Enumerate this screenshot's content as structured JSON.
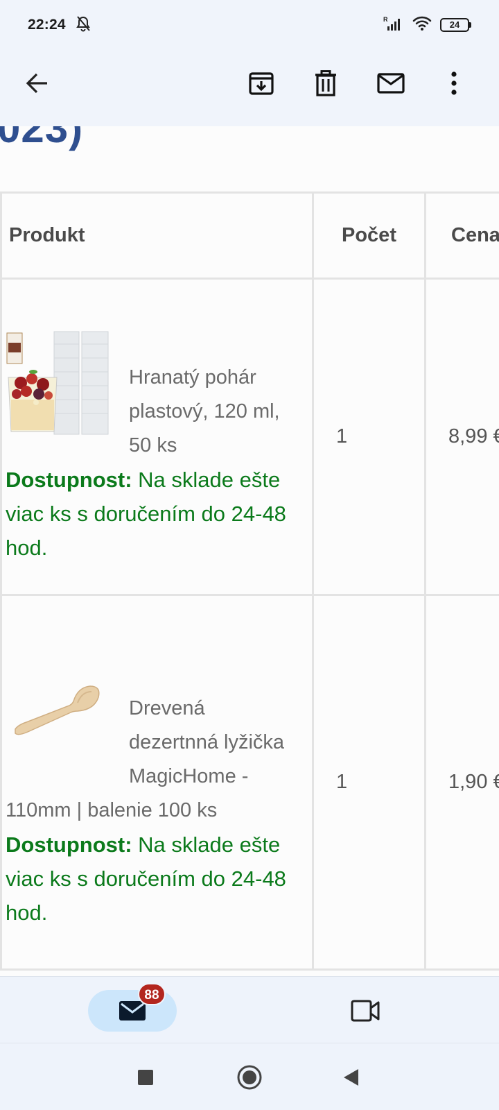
{
  "status": {
    "time": "22:24",
    "battery": "24",
    "icons": [
      "bell-off-icon",
      "signal-icon",
      "wifi-icon",
      "battery-icon"
    ]
  },
  "toolbar": {
    "icons": [
      "back-arrow-icon",
      "archive-icon",
      "delete-icon",
      "mail-unread-icon",
      "more-vert-icon"
    ]
  },
  "email": {
    "partial_heading": "023)",
    "table": {
      "headers": {
        "product": "Produkt",
        "count": "Počet",
        "price": "Cena"
      },
      "rows": [
        {
          "name_first": "Hranatý pohár",
          "name_rest": "plastový, 120 ml, 50 ks",
          "availability_label": "Dostupnost:",
          "availability_text": "Na sklade ešte viac ks s doručením do 24-48 hod.",
          "count": "1",
          "price": "8,99 €"
        },
        {
          "name_first": "Drevená",
          "name_rest": "dezertnná lyžička MagicHome - 110mm | balenie 100 ks",
          "availability_label": "Dostupnost:",
          "availability_text": "Na sklade ešte viac ks s doručením do 24-48 hod.",
          "count": "1",
          "price": "1,90 €"
        }
      ]
    }
  },
  "bottom_nav": {
    "mail_badge": "88",
    "icons": [
      "mail-icon",
      "video-camera-icon"
    ]
  },
  "colors": {
    "accent_tab": "#cce6fb",
    "badge": "#b3261e",
    "availability": "#0b7a1b",
    "heading": "#2f4f8f"
  }
}
